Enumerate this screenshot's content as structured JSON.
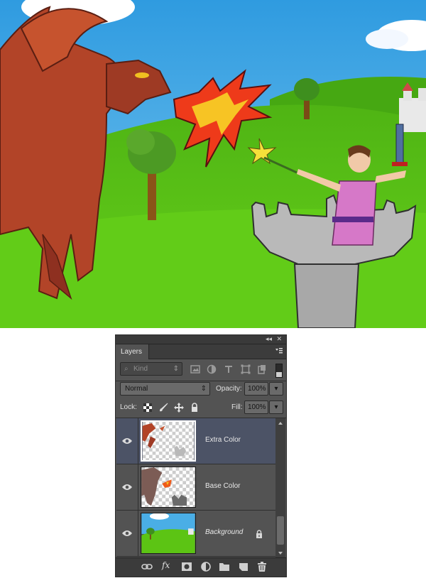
{
  "panel": {
    "tab_label": "Layers",
    "collapse_glyph": "◂◂",
    "close_glyph": "✕",
    "filter": {
      "placeholder": "Kind",
      "search_glyph": "⌕",
      "arrows": "⇕"
    },
    "blend_mode": {
      "value": "Normal",
      "arrows": "⇕"
    },
    "opacity": {
      "label": "Opacity:",
      "value": "100%"
    },
    "lock": {
      "label": "Lock:"
    },
    "fill": {
      "label": "Fill:",
      "value": "100%"
    },
    "dropdown_glyph": "▾",
    "layers": [
      {
        "name": "Extra Color",
        "selected": true,
        "visible": true,
        "locked": false,
        "italic": false
      },
      {
        "name": "Base Color",
        "selected": false,
        "visible": true,
        "locked": false,
        "italic": false
      },
      {
        "name": "Background",
        "selected": false,
        "visible": true,
        "locked": true,
        "italic": true
      }
    ],
    "footer_icons": [
      "link-layers-icon",
      "fx-icon",
      "add-mask-icon",
      "adjustment-layer-icon",
      "new-group-icon",
      "new-layer-icon",
      "trash-icon"
    ],
    "fx_label": "fx"
  },
  "colors": {
    "panel_bg": "#535353",
    "selected_row": "#4c5366",
    "sky": "#4aaee6",
    "grass": "#5cc414"
  }
}
